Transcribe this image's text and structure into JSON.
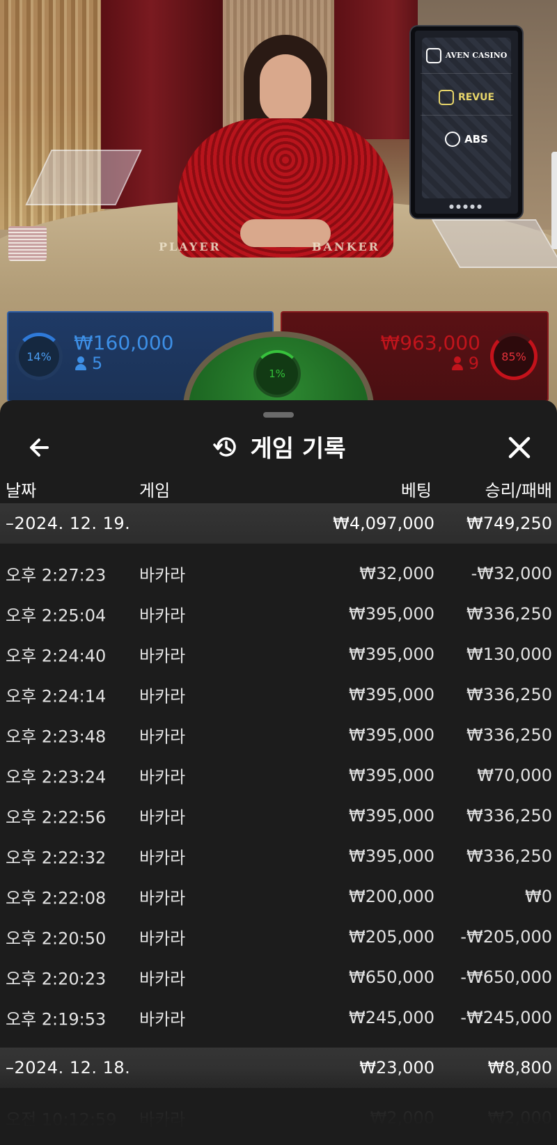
{
  "table": {
    "felt_player": "PLAYER",
    "felt_banker": "BANKER",
    "sponsors": [
      "AVEN CASINO",
      "REVUE",
      "ABS"
    ],
    "player": {
      "percent": "14%",
      "amount": "₩160,000",
      "count": "5",
      "color": "#3d8fe6"
    },
    "tie": {
      "percent": "1%",
      "color": "#33c03a"
    },
    "banker": {
      "percent": "85%",
      "amount": "₩963,000",
      "count": "9",
      "color": "#c1141c"
    }
  },
  "sheet": {
    "title": "게임 기록",
    "columns": {
      "date": "날짜",
      "game": "게임",
      "bet": "베팅",
      "result": "승리/패배"
    },
    "groups": [
      {
        "date": "–2024. 12. 19.",
        "bet": "₩4,097,000",
        "result": "₩749,250",
        "rows": [
          {
            "time": "오후 2:27:23",
            "game": "바카라",
            "bet": "₩32,000",
            "result": "-₩32,000"
          },
          {
            "time": "오후 2:25:04",
            "game": "바카라",
            "bet": "₩395,000",
            "result": "₩336,250"
          },
          {
            "time": "오후 2:24:40",
            "game": "바카라",
            "bet": "₩395,000",
            "result": "₩130,000"
          },
          {
            "time": "오후 2:24:14",
            "game": "바카라",
            "bet": "₩395,000",
            "result": "₩336,250"
          },
          {
            "time": "오후 2:23:48",
            "game": "바카라",
            "bet": "₩395,000",
            "result": "₩336,250"
          },
          {
            "time": "오후 2:23:24",
            "game": "바카라",
            "bet": "₩395,000",
            "result": "₩70,000"
          },
          {
            "time": "오후 2:22:56",
            "game": "바카라",
            "bet": "₩395,000",
            "result": "₩336,250"
          },
          {
            "time": "오후 2:22:32",
            "game": "바카라",
            "bet": "₩395,000",
            "result": "₩336,250"
          },
          {
            "time": "오후 2:22:08",
            "game": "바카라",
            "bet": "₩200,000",
            "result": "₩0"
          },
          {
            "time": "오후 2:20:50",
            "game": "바카라",
            "bet": "₩205,000",
            "result": "-₩205,000"
          },
          {
            "time": "오후 2:20:23",
            "game": "바카라",
            "bet": "₩650,000",
            "result": "-₩650,000"
          },
          {
            "time": "오후 2:19:53",
            "game": "바카라",
            "bet": "₩245,000",
            "result": "-₩245,000"
          }
        ]
      },
      {
        "date": "–2024. 12. 18.",
        "bet": "₩23,000",
        "result": "₩8,800",
        "rows": [
          {
            "time": "오전 10:12:59",
            "game": "바카라",
            "bet": "₩2,000",
            "result": "₩2,000"
          }
        ]
      }
    ]
  },
  "icons": {
    "back": "arrow-left-icon",
    "history": "history-icon",
    "close": "close-icon",
    "user": "user-icon"
  }
}
